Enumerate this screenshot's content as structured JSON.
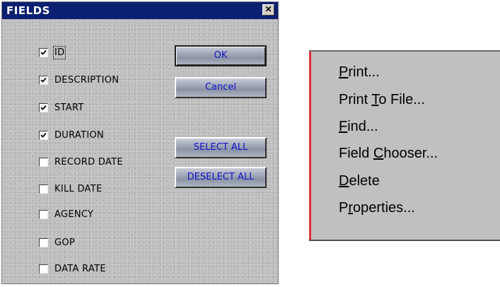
{
  "dialog": {
    "title": "FIELDS",
    "close_glyph": "✕",
    "fields": [
      {
        "label": "ID",
        "checked": true
      },
      {
        "label": "DESCRIPTION",
        "checked": true
      },
      {
        "label": "START",
        "checked": true
      },
      {
        "label": "DURATION",
        "checked": true
      },
      {
        "label": "RECORD DATE",
        "checked": false
      },
      {
        "label": "KILL DATE",
        "checked": false
      },
      {
        "label": "AGENCY",
        "checked": false
      },
      {
        "label": "GOP",
        "checked": false
      },
      {
        "label": "DATA RATE",
        "checked": false
      }
    ],
    "ok_label": "OK",
    "cancel_label": "Cancel",
    "select_all_label": "SELECT ALL",
    "deselect_all_label": "DESELECT ALL"
  },
  "menu": {
    "items": [
      {
        "before": "",
        "key": "P",
        "after": "rint..."
      },
      {
        "before": "Print ",
        "key": "T",
        "after": "o File..."
      },
      {
        "before": "",
        "key": "F",
        "after": "ind..."
      },
      {
        "before": "Field ",
        "key": "C",
        "after": "hooser..."
      },
      {
        "before": "",
        "key": "D",
        "after": "elete"
      },
      {
        "before": "P",
        "key": "r",
        "after": "operties..."
      }
    ]
  },
  "colors": {
    "titlebar": "#0b2070",
    "button_text": "#1414c8",
    "menu_left_border": "#e2303a"
  }
}
